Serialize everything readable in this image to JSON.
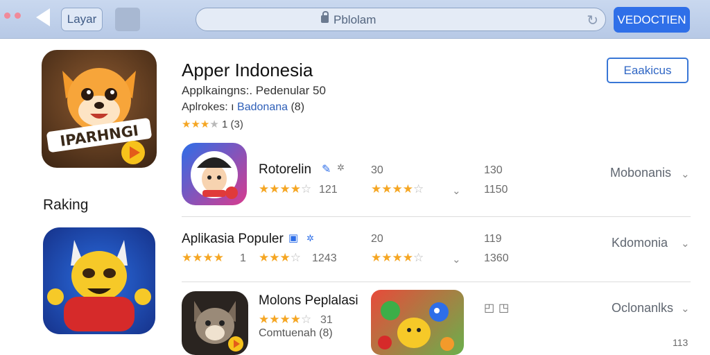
{
  "toolbar": {
    "button_label": "Layar",
    "address_text": "Pblolam",
    "primary_button": "VEDOCTIEN"
  },
  "hero": {
    "title": "Apper Indonesia",
    "subtitle": "Applkaingns:. Pedenular 50",
    "author_prefix": "Aplrokes: ı",
    "author_link": "Badonana",
    "author_suffix": "(8)",
    "rating_count": "1 (3)",
    "action_button": "Eaakicus",
    "icon_text": "IPARHNGI"
  },
  "section_label": "Raking",
  "rows": [
    {
      "title": "Rotorelin",
      "rating_text": "121",
      "col_num_a": "30",
      "col_num_b1": "130",
      "col_num_b2": "1150",
      "category": "Mobonanis"
    },
    {
      "title": "Aplikasia Populer",
      "rating_text_a": "1",
      "rating_text_b": "1243",
      "col_num_a": "20",
      "col_num_b1": "119",
      "col_num_b2": "1360",
      "category": "Kdomonia"
    },
    {
      "title": "Molons Peplalasi",
      "rating_text": "31",
      "sub_text": "Comtuenah (8)",
      "category": "Oclonanlks",
      "corner_text": "113"
    }
  ],
  "colors": {
    "accent": "#2f6fe8",
    "star": "#f5a623",
    "link": "#2e5fb8"
  }
}
